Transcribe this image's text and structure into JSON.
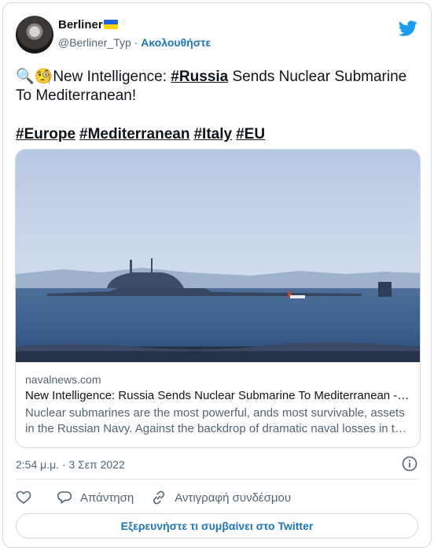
{
  "author": {
    "display_name": "Berliner",
    "handle": "@Berliner_Typ",
    "follow_label": "Ακολουθήστε",
    "separator": "·"
  },
  "tweet": {
    "emoji": "🔍🧐",
    "text_before": "New Intelligence: ",
    "text_highlight": "#Russia",
    "text_after": " Sends Nuclear Submarine To Mediterranean!",
    "hashtags": [
      "#Europe",
      "#Mediterranean",
      "#Italy",
      "#EU"
    ]
  },
  "link_card": {
    "domain": "navalnews.com",
    "title": "New Intelligence: Russia Sends Nuclear Submarine To Mediterranean - Naval News",
    "description": "Nuclear submarines are the most powerful, ands most survivable, assets in the Russian Navy. Against the backdrop of dramatic naval losses in the Black Sea..."
  },
  "timestamp": "2:54 μ.μ. · 3 Σεπ 2022",
  "actions": {
    "reply_label": "Απάντηση",
    "copy_link_label": "Αντιγραφή συνδέσμου"
  },
  "explore_label": "Εξερευνήστε τι συμβαίνει στο Twitter",
  "colors": {
    "link_blue": "#1d76b5",
    "twitter_blue": "#1d9bf0",
    "muted_text": "#536471",
    "border": "#cfd9de"
  },
  "icons": {
    "logo": "twitter-bird-icon",
    "info": "info-icon",
    "like": "heart-icon",
    "reply": "reply-bubble-icon",
    "copy": "link-icon"
  }
}
